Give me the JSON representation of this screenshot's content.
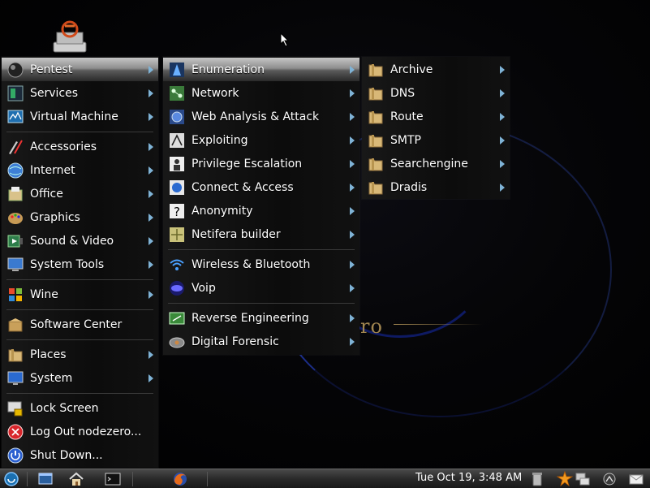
{
  "desktop": {
    "wallpaper_text": "ro"
  },
  "main_menu": {
    "items": [
      {
        "label": "Pentest",
        "icon": "pentest-icon",
        "submenu": true
      },
      {
        "label": "Services",
        "icon": "services-icon",
        "submenu": true
      },
      {
        "label": "Virtual Machine",
        "icon": "virtual-machine-icon",
        "submenu": true
      },
      {
        "label": "Accessories",
        "icon": "accessories-icon",
        "submenu": true
      },
      {
        "label": "Internet",
        "icon": "internet-globe-icon",
        "submenu": true
      },
      {
        "label": "Office",
        "icon": "office-icon",
        "submenu": true
      },
      {
        "label": "Graphics",
        "icon": "graphics-palette-icon",
        "submenu": true
      },
      {
        "label": "Sound & Video",
        "icon": "sound-video-icon",
        "submenu": true
      },
      {
        "label": "System Tools",
        "icon": "system-tools-icon",
        "submenu": true
      },
      {
        "label": "Wine",
        "icon": "wine-icon",
        "submenu": true
      },
      {
        "label": "Software Center",
        "icon": "software-center-icon",
        "submenu": false
      },
      {
        "label": "Places",
        "icon": "places-folder-icon",
        "submenu": true
      },
      {
        "label": "System",
        "icon": "system-monitor-icon",
        "submenu": true
      },
      {
        "label": "Lock Screen",
        "icon": "lock-screen-icon",
        "submenu": false
      },
      {
        "label": "Log Out nodezero...",
        "icon": "log-out-icon",
        "submenu": false
      },
      {
        "label": "Shut Down...",
        "icon": "shut-down-icon",
        "submenu": false
      }
    ]
  },
  "pentest_menu": {
    "items": [
      {
        "label": "Enumeration",
        "icon": "enumeration-icon"
      },
      {
        "label": "Network",
        "icon": "network-icon"
      },
      {
        "label": "Web Analysis & Attack",
        "icon": "web-analysis-icon"
      },
      {
        "label": "Exploiting",
        "icon": "exploiting-icon"
      },
      {
        "label": "Privilege Escalation",
        "icon": "privilege-escalation-icon"
      },
      {
        "label": "Connect & Access",
        "icon": "connect-access-icon"
      },
      {
        "label": "Anonymity",
        "icon": "anonymity-icon"
      },
      {
        "label": "Netifera builder",
        "icon": "netifera-icon"
      },
      {
        "label": "Wireless & Bluetooth",
        "icon": "wireless-icon"
      },
      {
        "label": "Voip",
        "icon": "voip-icon"
      },
      {
        "label": "Reverse Engineering",
        "icon": "reverse-engineering-icon"
      },
      {
        "label": "Digital Forensic",
        "icon": "digital-forensic-icon"
      }
    ]
  },
  "enumeration_menu": {
    "items": [
      {
        "label": "Archive",
        "icon": "folder-icon"
      },
      {
        "label": "DNS",
        "icon": "folder-icon"
      },
      {
        "label": "Route",
        "icon": "folder-icon"
      },
      {
        "label": "SMTP",
        "icon": "folder-icon"
      },
      {
        "label": "Searchengine",
        "icon": "folder-icon"
      },
      {
        "label": "Dradis",
        "icon": "folder-icon"
      }
    ]
  },
  "taskbar": {
    "clock": "Tue Oct 19,  3:48 AM"
  },
  "colors": {
    "menu_bg": "#111111",
    "active_highlight": "#8e8e8e",
    "arrow": "#7fb3d6",
    "folder": "#d8b877"
  }
}
